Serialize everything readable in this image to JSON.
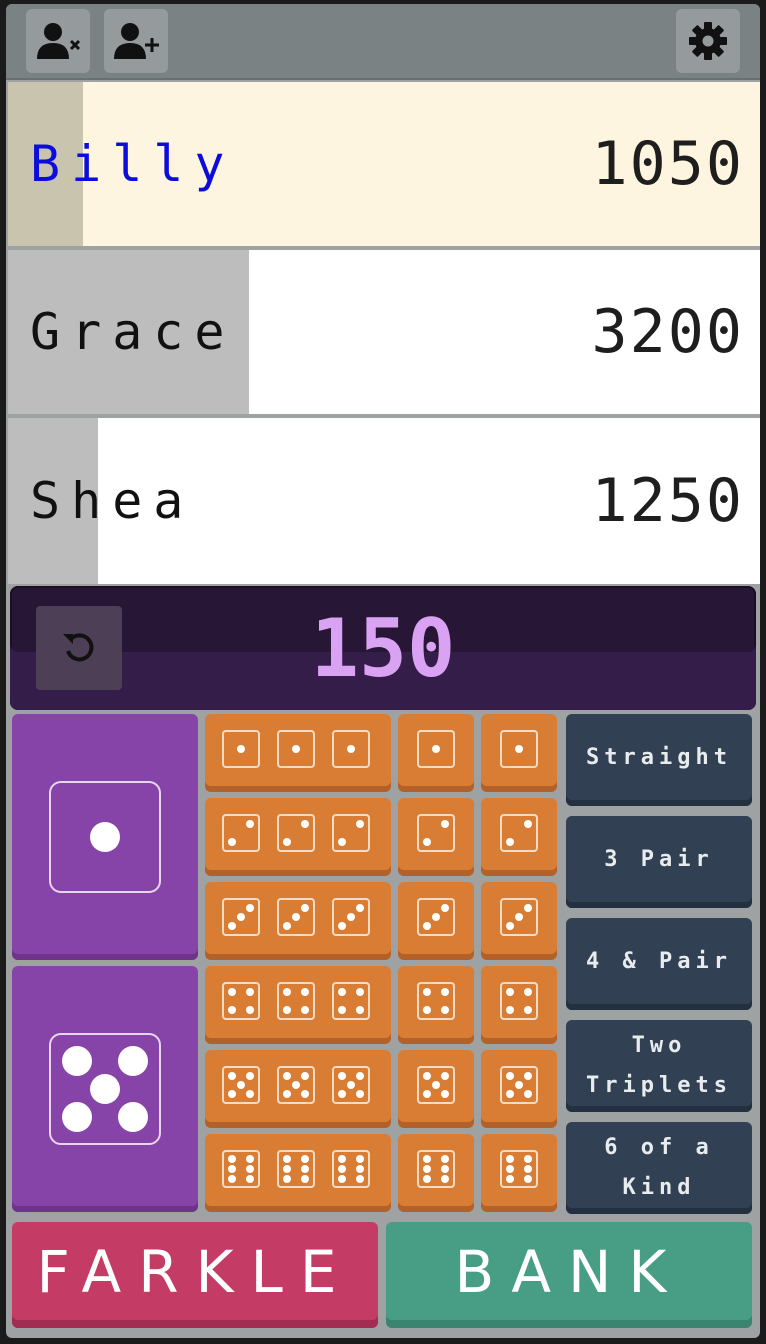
{
  "topbar": {
    "buttons": [
      {
        "icon": "remove-player-icon"
      },
      {
        "icon": "add-player-icon"
      },
      {
        "icon": "gear-icon"
      }
    ]
  },
  "players": [
    {
      "name": "Billy",
      "score": "1050",
      "active": true,
      "name_color": "#0c0cdc",
      "progress": 0.1
    },
    {
      "name": "Grace",
      "score": "3200",
      "active": false,
      "name_color": "#111111",
      "progress": 0.32
    },
    {
      "name": "Shea",
      "score": "1250",
      "active": false,
      "name_color": "#111111",
      "progress": 0.12
    }
  ],
  "turn": {
    "score": "150",
    "undo_icon": "undo-icon"
  },
  "dice_buttons": [
    {
      "face": 1
    },
    {
      "face": 5
    }
  ],
  "scoring_rows": [
    1,
    2,
    3,
    4,
    5,
    6
  ],
  "combos": [
    {
      "label": "Straight"
    },
    {
      "label": "3 Pair"
    },
    {
      "label": "4 & Pair"
    },
    {
      "label": "Two Triplets"
    },
    {
      "label": "6 of a Kind"
    }
  ],
  "actions": {
    "farkle_label": "FARKLE",
    "bank_label": "BANK"
  },
  "colors": {
    "active_row": "#fdf5df",
    "turn_score": "#d9a2f2",
    "dice_purple": "#8744a8",
    "tile_orange": "#d97d34",
    "combo_navy": "#314153",
    "farkle_red": "#c43c66",
    "bank_green": "#489d85"
  }
}
